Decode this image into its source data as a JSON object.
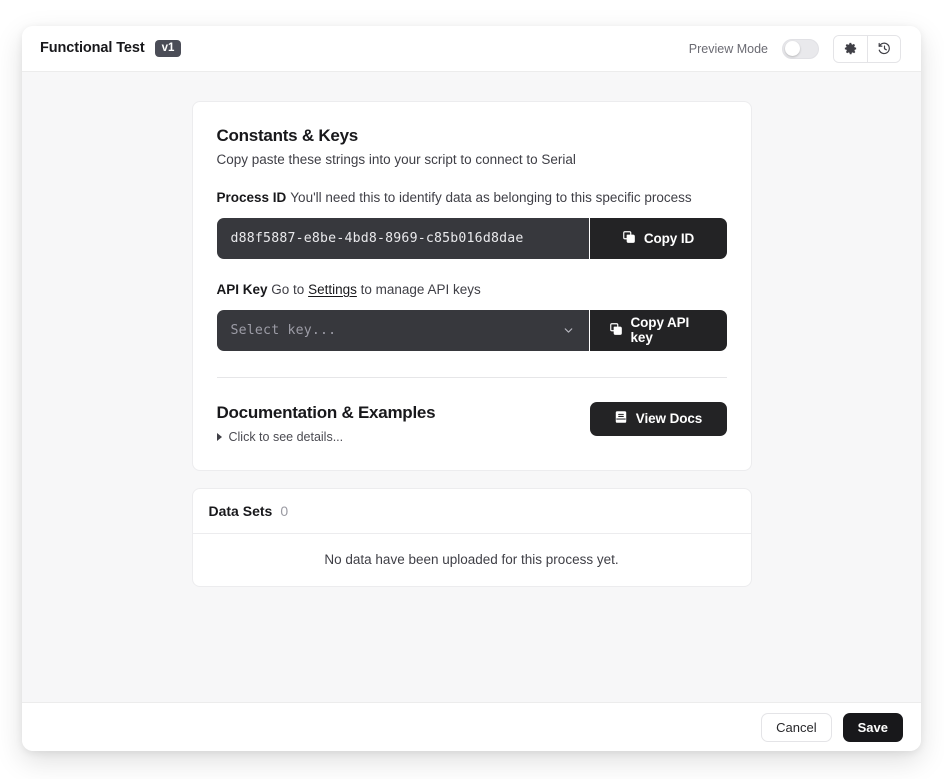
{
  "header": {
    "title": "Functional Test",
    "version_badge": "v1",
    "preview_mode_label": "Preview Mode",
    "preview_mode_enabled": false,
    "settings_icon": "gear-icon",
    "history_icon": "history-revert-icon"
  },
  "constants_card": {
    "heading": "Constants & Keys",
    "subheading": "Copy paste these strings into your script to connect to Serial",
    "process_id": {
      "label": "Process ID",
      "help": "You'll need this to identify data as belonging to this specific process",
      "value": "d88f5887-e8be-4bd8-8969-c85b016d8dae",
      "copy_button": "Copy ID",
      "copy_icon": "copy-icon"
    },
    "api_key": {
      "label": "API Key",
      "help_prefix": "Go to",
      "help_link": "Settings",
      "help_suffix": "to manage API keys",
      "placeholder": "Select key...",
      "selected_value": "",
      "chevron_icon": "chevron-down-icon",
      "copy_button": "Copy API key",
      "copy_icon": "copy-icon"
    },
    "documentation": {
      "heading": "Documentation & Examples",
      "details_toggle": "Click to see details...",
      "expanded": false,
      "view_docs_button": "View Docs",
      "book_icon": "book-icon"
    }
  },
  "datasets_card": {
    "title": "Data Sets",
    "count": "0",
    "empty_message": "No data have been uploaded for this process yet."
  },
  "footer": {
    "cancel_label": "Cancel",
    "save_label": "Save"
  },
  "colors": {
    "page_background": "#ffffff",
    "modal_background": "#ffffff",
    "body_background": "#f7f7f8",
    "dark_input": "#37383d",
    "dark_button": "#232325",
    "primary_button": "#18181b",
    "badge": "#4b4d57",
    "border": "#ececee"
  }
}
